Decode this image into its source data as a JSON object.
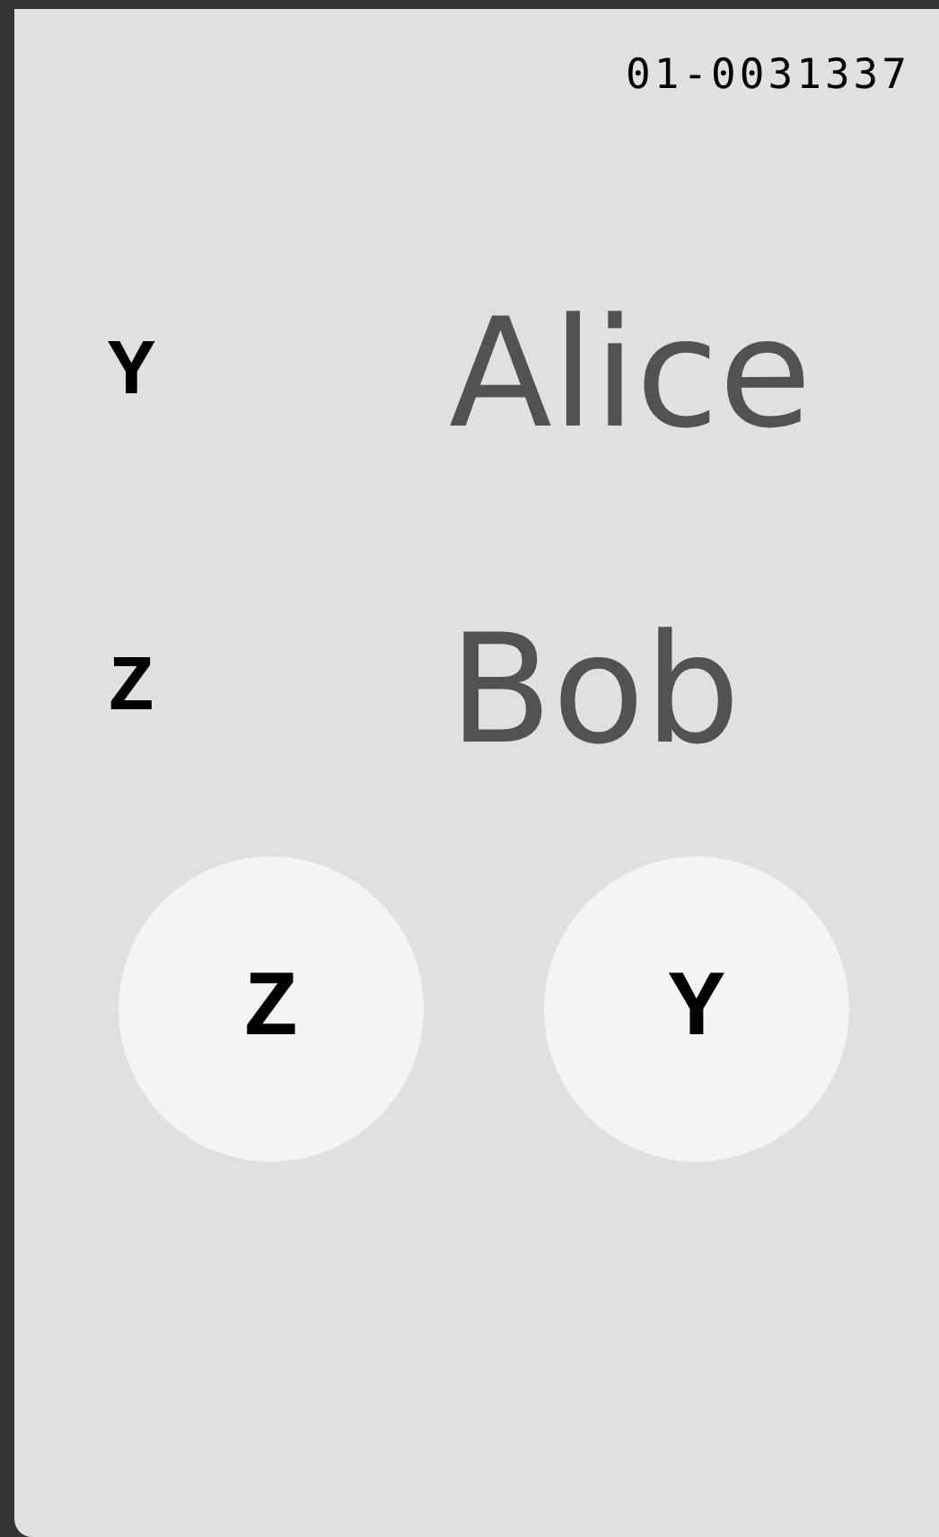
{
  "id": "01-0031337",
  "rows": [
    {
      "key": "Y",
      "name": "Alice"
    },
    {
      "key": "Z",
      "name": "Bob"
    }
  ],
  "buttons": [
    "Z",
    "Y"
  ]
}
